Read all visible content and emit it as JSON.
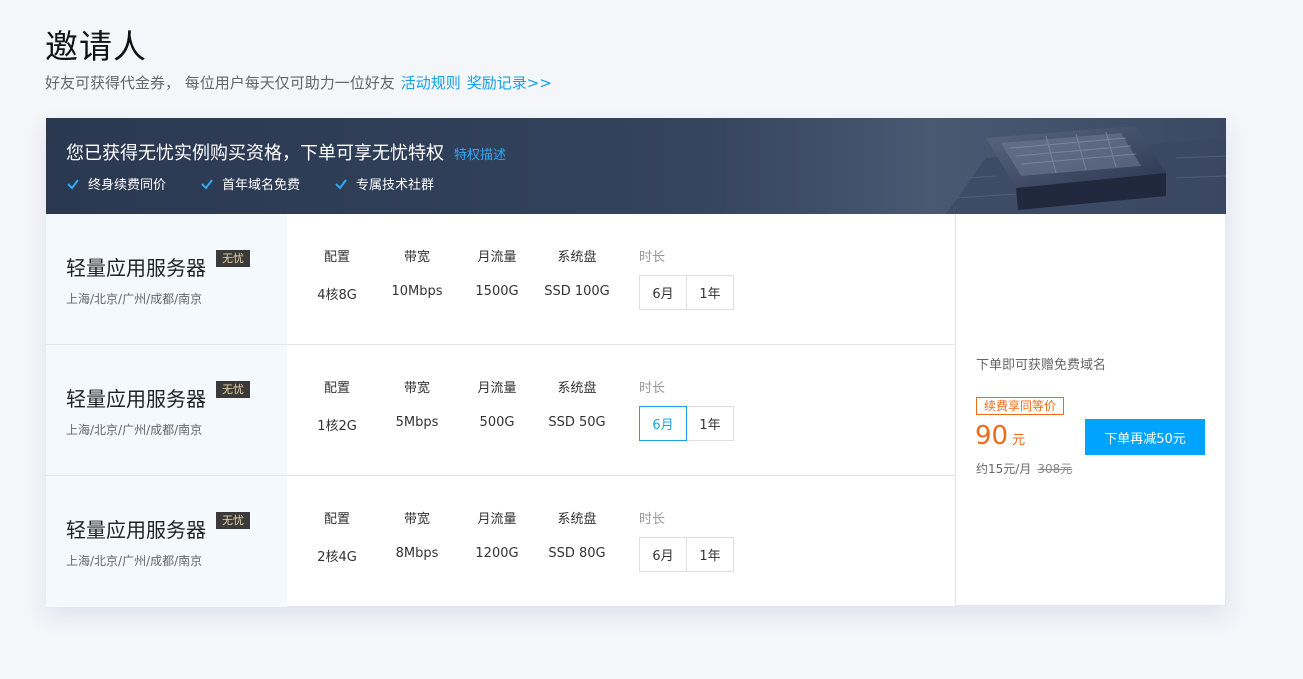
{
  "header": {
    "title": "邀请人",
    "subtitle": "好友可获得代金券， 每位用户每天仅可助力一位好友",
    "rules_link": "活动规则",
    "records_link": "奖励记录>>"
  },
  "banner": {
    "title": "您已获得无忧实例购买资格，下单可享无忧特权",
    "link": "特权描述",
    "perks": [
      "终身续费同价",
      "首年域名免费",
      "专属技术社群"
    ]
  },
  "spec_labels": {
    "config": "配置",
    "bandwidth": "带宽",
    "traffic": "月流量",
    "disk": "系统盘",
    "duration": "时长"
  },
  "products": [
    {
      "name": "轻量应用服务器",
      "badge": "无忧",
      "regions": "上海/北京/广州/成都/南京",
      "config": "4核8G",
      "bandwidth": "10Mbps",
      "traffic": "1500G",
      "disk": "SSD 100G",
      "durations": [
        "6月",
        "1年"
      ],
      "selected_duration": ""
    },
    {
      "name": "轻量应用服务器",
      "badge": "无忧",
      "regions": "上海/北京/广州/成都/南京",
      "config": "1核2G",
      "bandwidth": "5Mbps",
      "traffic": "500G",
      "disk": "SSD 50G",
      "durations": [
        "6月",
        "1年"
      ],
      "selected_duration": "6月"
    },
    {
      "name": "轻量应用服务器",
      "badge": "无忧",
      "regions": "上海/北京/广州/成都/南京",
      "config": "2核4G",
      "bandwidth": "8Mbps",
      "traffic": "1200G",
      "disk": "SSD 80G",
      "durations": [
        "6月",
        "1年"
      ],
      "selected_duration": ""
    }
  ],
  "side": {
    "description": "下单即可获赠免费域名",
    "tag": "续费享同等价",
    "price": "90",
    "price_unit": "元",
    "monthly": "约15元/月",
    "original_price": "308元",
    "buy_button": "下单再减50元"
  },
  "colors": {
    "accent": "#00a4ff",
    "link": "#1aa0e6",
    "price": "#f06a1a",
    "banner": "#2f3d57"
  }
}
